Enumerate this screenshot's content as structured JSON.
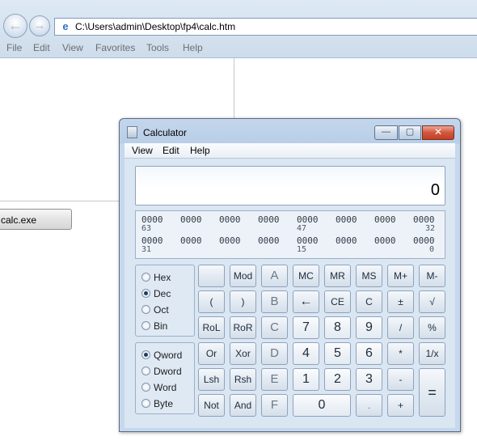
{
  "browser": {
    "address": "C:\\Users\\admin\\Desktop\\fp4\\calc.htm",
    "menu": [
      "File",
      "Edit",
      "View",
      "Favorites",
      "Tools",
      "Help"
    ],
    "page_button": "calc.exe"
  },
  "calculator": {
    "title": "Calculator",
    "menu": [
      "View",
      "Edit",
      "Help"
    ],
    "display": "0",
    "bits": {
      "row1": [
        "0000",
        "0000",
        "0000",
        "0000",
        "0000",
        "0000",
        "0000",
        "0000"
      ],
      "row1_indices": [
        "63",
        "47",
        "32"
      ],
      "row2": [
        "0000",
        "0000",
        "0000",
        "0000",
        "0000",
        "0000",
        "0000",
        "0000"
      ],
      "row2_indices": [
        "31",
        "15",
        "0"
      ]
    },
    "base_options": [
      "Hex",
      "Dec",
      "Oct",
      "Bin"
    ],
    "base_selected": "Dec",
    "word_options": [
      "Qword",
      "Dword",
      "Word",
      "Byte"
    ],
    "word_selected": "Qword",
    "keys": {
      "row1": [
        "",
        "Mod",
        "A",
        "MC",
        "MR",
        "MS",
        "M+",
        "M-"
      ],
      "row2": [
        "(",
        ")",
        "B",
        "←",
        "CE",
        "C",
        "±",
        "√"
      ],
      "row3": [
        "RoL",
        "RoR",
        "C",
        "7",
        "8",
        "9",
        "/",
        "%"
      ],
      "row4": [
        "Or",
        "Xor",
        "D",
        "4",
        "5",
        "6",
        "*",
        "1/x"
      ],
      "row5": [
        "Lsh",
        "Rsh",
        "E",
        "1",
        "2",
        "3",
        "-",
        "="
      ],
      "row6": [
        "Not",
        "And",
        "F",
        "0",
        ".",
        "+"
      ]
    }
  }
}
